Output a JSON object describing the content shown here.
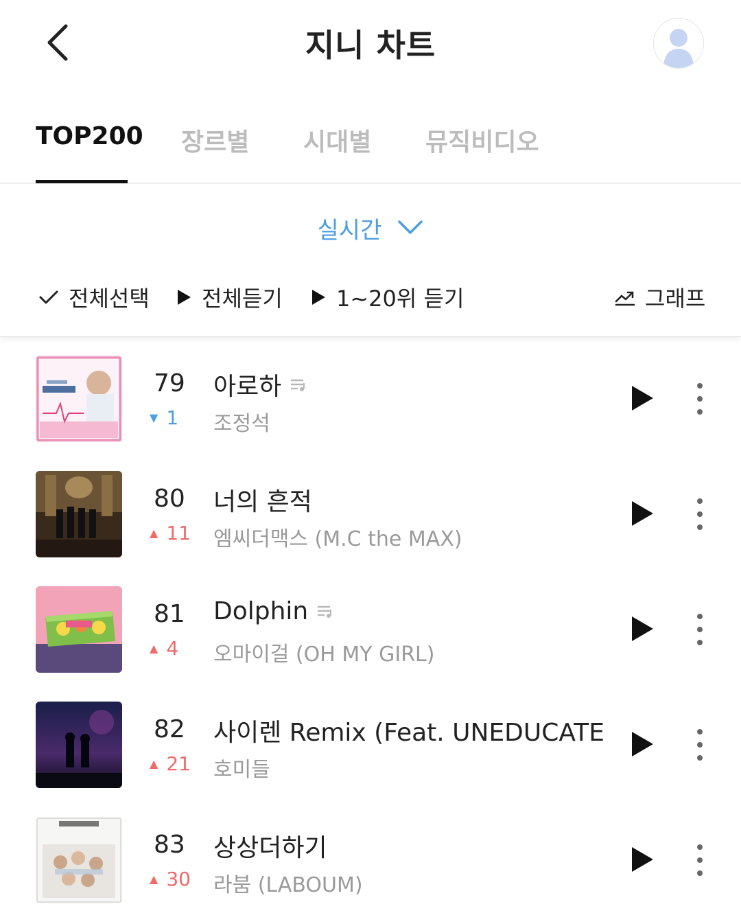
{
  "header": {
    "title": "지니 차트",
    "back_icon": "chevron-left-icon",
    "avatar_icon": "user-avatar-icon"
  },
  "tabs": [
    {
      "label": "TOP200",
      "active": true
    },
    {
      "label": "장르별",
      "active": false
    },
    {
      "label": "시대별",
      "active": false
    },
    {
      "label": "뮤직비디오",
      "active": false
    }
  ],
  "period": {
    "label": "실시간",
    "icon": "chevron-down-icon"
  },
  "actions": {
    "select_all": "전체선택",
    "play_all": "전체듣기",
    "play_top20": "1~20위 듣기",
    "graph": "그래프"
  },
  "colors": {
    "accent_blue": "#4a9ee2",
    "rank_up": "#f06a6a",
    "rank_down": "#4a9ee2",
    "inactive_tab": "#bcbcbc"
  },
  "songs": [
    {
      "rank": "79",
      "change": "1",
      "direction": "down",
      "title": "아로하",
      "artist": "조정석",
      "has_lyrics_icon": true
    },
    {
      "rank": "80",
      "change": "11",
      "direction": "up",
      "title": "너의 흔적",
      "artist": "엠씨더맥스 (M.C the MAX)",
      "has_lyrics_icon": false
    },
    {
      "rank": "81",
      "change": "4",
      "direction": "up",
      "title": "Dolphin",
      "artist": "오마이걸 (OH MY GIRL)",
      "has_lyrics_icon": true
    },
    {
      "rank": "82",
      "change": "21",
      "direction": "up",
      "title": "사이렌 Remix (Feat. UNEDUCATE..",
      "artist": "호미들",
      "has_lyrics_icon": false
    },
    {
      "rank": "83",
      "change": "30",
      "direction": "up",
      "title": "상상더하기",
      "artist": "라붐 (LABOUM)",
      "has_lyrics_icon": false
    }
  ]
}
